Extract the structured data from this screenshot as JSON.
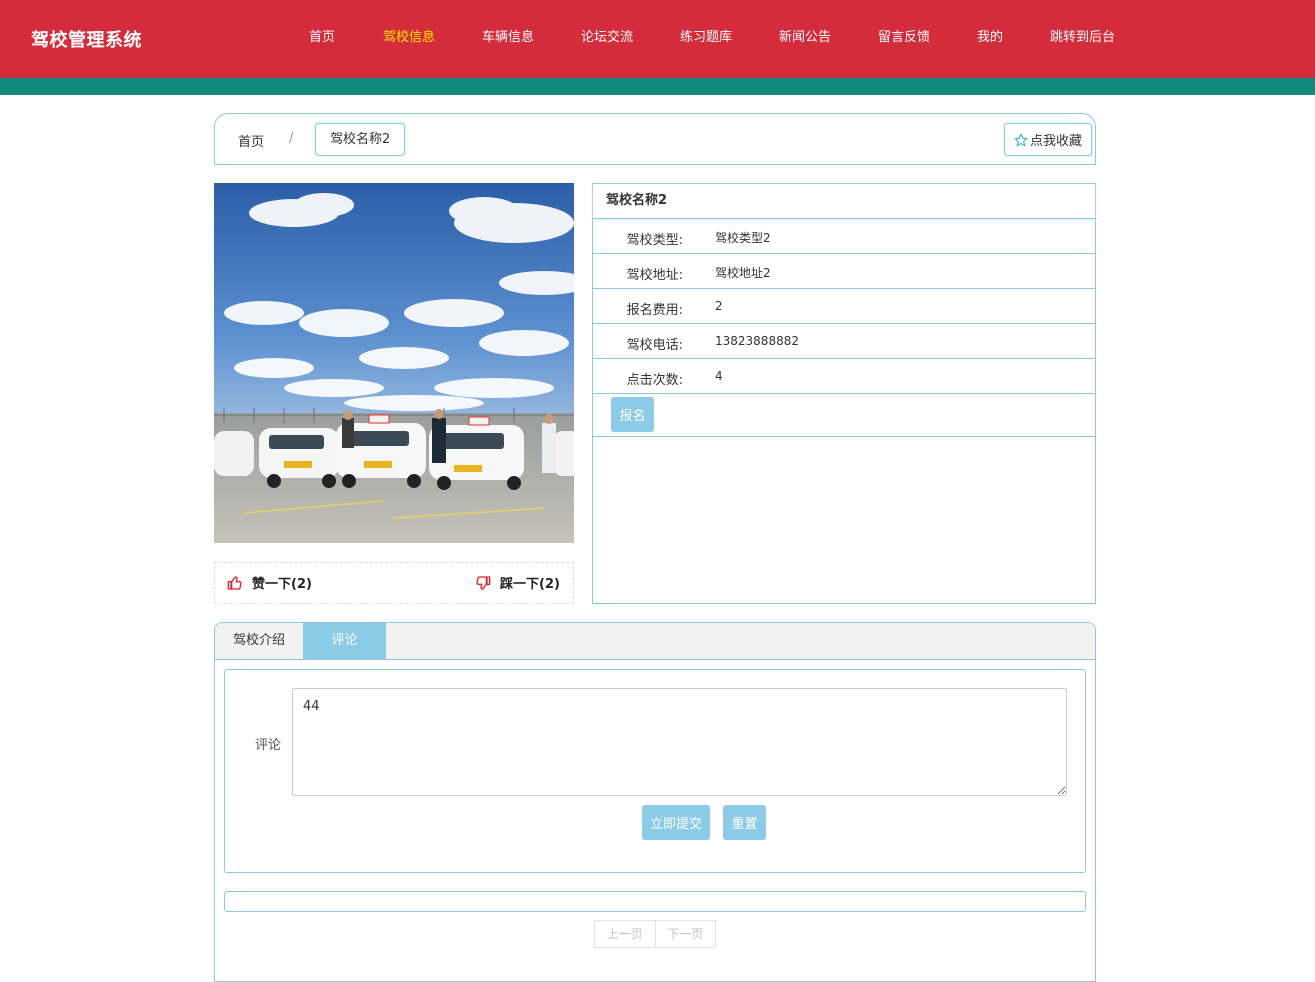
{
  "header": {
    "brand": "驾校管理系统",
    "nav": [
      {
        "label": "首页",
        "active": false
      },
      {
        "label": "驾校信息",
        "active": true
      },
      {
        "label": "车辆信息",
        "active": false
      },
      {
        "label": "论坛交流",
        "active": false
      },
      {
        "label": "练习题库",
        "active": false
      },
      {
        "label": "新闻公告",
        "active": false
      },
      {
        "label": "留言反馈",
        "active": false
      },
      {
        "label": "我的",
        "active": false
      },
      {
        "label": "跳转到后台",
        "active": false
      }
    ]
  },
  "breadcrumb": {
    "home": "首页",
    "separator": "/",
    "current": "驾校名称2",
    "favorite_label": "点我收藏"
  },
  "votes": {
    "like_label": "赞一下(2)",
    "dislike_label": "踩一下(2)"
  },
  "details": {
    "title": "驾校名称2",
    "rows": [
      {
        "label": "驾校类型:",
        "value": "驾校类型2"
      },
      {
        "label": "驾校地址:",
        "value": "驾校地址2"
      },
      {
        "label": "报名费用:",
        "value": "2"
      },
      {
        "label": "驾校电话:",
        "value": "13823888882"
      },
      {
        "label": "点击次数:",
        "value": "4"
      }
    ],
    "signup_label": "报名"
  },
  "tabs": {
    "intro": "驾校介绍",
    "comment": "评论"
  },
  "comment_form": {
    "label": "评论",
    "value": "44",
    "submit_label": "立即提交",
    "reset_label": "重置"
  },
  "pager": {
    "prev": "上一页",
    "next": "下一页"
  },
  "colors": {
    "header_red": "#d52c3b",
    "stripe_teal": "#0f8a7a",
    "accent_blue": "#8ccbe8",
    "active_nav": "#ffe600"
  }
}
